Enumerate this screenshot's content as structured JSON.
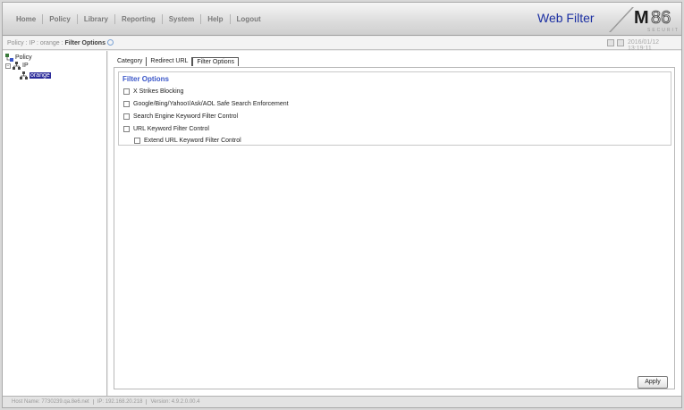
{
  "menu": [
    "Home",
    "Policy",
    "Library",
    "Reporting",
    "System",
    "Help",
    "Logout"
  ],
  "product": "Web Filter",
  "logo": {
    "text": "M86",
    "sub": "SECURITY"
  },
  "breadcrumb": {
    "path": "Policy : IP : orange : ",
    "current": "Filter Options"
  },
  "clock": "2016/01/12 13:19:11",
  "tree": {
    "root": "Policy",
    "child": "IP",
    "selected": "orange"
  },
  "tabs": [
    "Category",
    "Redirect URL",
    "Filter Options"
  ],
  "filter_options": {
    "title": "Filter Options",
    "items": [
      {
        "label": "X Strikes Blocking",
        "checked": false
      },
      {
        "label": "Google/Bing/Yahoo!/Ask/AOL Safe Search Enforcement",
        "checked": false
      },
      {
        "label": "Search Engine Keyword Filter Control",
        "checked": false
      },
      {
        "label": "URL Keyword Filter Control",
        "checked": false
      },
      {
        "label": "Extend URL Keyword Filter Control",
        "checked": false
      }
    ]
  },
  "apply_label": "Apply",
  "status": {
    "host": "Host Name: 7730239.qa.8e6.net",
    "ip": "IP: 192.168.20.218",
    "version": "Version: 4.9.2.0.00.4"
  },
  "colors": {
    "brand": "#1b2fa2",
    "title": "#3a56c8",
    "selection": "#2b2b9a"
  }
}
